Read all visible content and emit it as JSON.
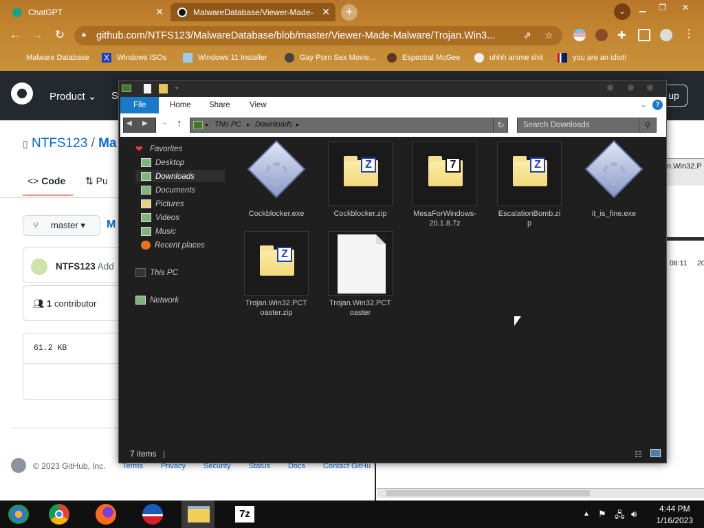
{
  "browser": {
    "tabs": [
      {
        "title": "ChatGPT",
        "close": "✕"
      },
      {
        "title": "MalwareDatabase/Viewer-Made-",
        "close": "✕"
      }
    ],
    "new_tab": "+",
    "url": "github.com/NTFS123/MalwareDatabase/blob/master/Viewer-Made-Malware/Trojan.Win3...",
    "bookmarks": [
      "Malware Database",
      "Windows ISOs",
      "Windows 11 Installer",
      "Gay Porn Sex Movie...",
      "Espectral McGee",
      "uhhh anime shit",
      "you are an idiot!"
    ]
  },
  "github": {
    "nav_product": "Product",
    "nav_s": "S",
    "signup": "up",
    "repo_owner": "NTFS123",
    "repo_sep": "/",
    "repo_name": "Ma",
    "tab_code": "Code",
    "tab_pulls": "Pu",
    "branch": "master",
    "branch_trail": "M",
    "commit_author": "NTFS123",
    "commit_msg": "Add",
    "contributors_count": "1",
    "contributors_label": "contributor",
    "file_size": "61.2 KB",
    "footer": "© 2023 GitHub, Inc.",
    "footer_links": [
      "Terms",
      "Privacy",
      "Security",
      "Status",
      "Docs",
      "Contact GitHu"
    ],
    "right_tab_text": "n.Win32.P",
    "right_time": "08:11",
    "right_year": "20"
  },
  "explorer": {
    "ribbon_tabs": [
      "File",
      "Home",
      "Share",
      "View"
    ],
    "breadcrumb": [
      "This PC",
      "Downloads"
    ],
    "search_placeholder": "Search Downloads",
    "nav": {
      "favorites": "Favorites",
      "desktop": "Desktop",
      "downloads": "Downloads",
      "documents": "Documents",
      "pictures": "Pictures",
      "videos": "Videos",
      "music": "Music",
      "recent": "Recent places",
      "thispc": "This PC",
      "network": "Network"
    },
    "files": [
      {
        "name": "Cockblocker.exe",
        "type": "exe"
      },
      {
        "name": "Cockblocker.zip",
        "type": "zip"
      },
      {
        "name": "MesaForWindows-20.1.8.7z",
        "type": "7z"
      },
      {
        "name": "EscalationBomb.zip",
        "type": "zip"
      },
      {
        "name": "it_is_fine.exe",
        "type": "exe"
      },
      {
        "name": "Trojan.Win32.PCToaster.zip",
        "type": "zip"
      },
      {
        "name": "Trojan.Win32.PCToaster",
        "type": "file"
      }
    ],
    "status": "7 items"
  },
  "taskbar": {
    "time": "4:44 PM",
    "date": "1/16/2023",
    "apps": [
      "start",
      "chrome",
      "firefox",
      "obama",
      "file-explorer",
      "7zip"
    ],
    "sevenzip_label": "7z"
  },
  "colors": {
    "chrome_frame": "#c2852f",
    "gh_header": "#24292f",
    "file_tab": "#1979ca",
    "explorer_bg": "#1f1f1f"
  }
}
